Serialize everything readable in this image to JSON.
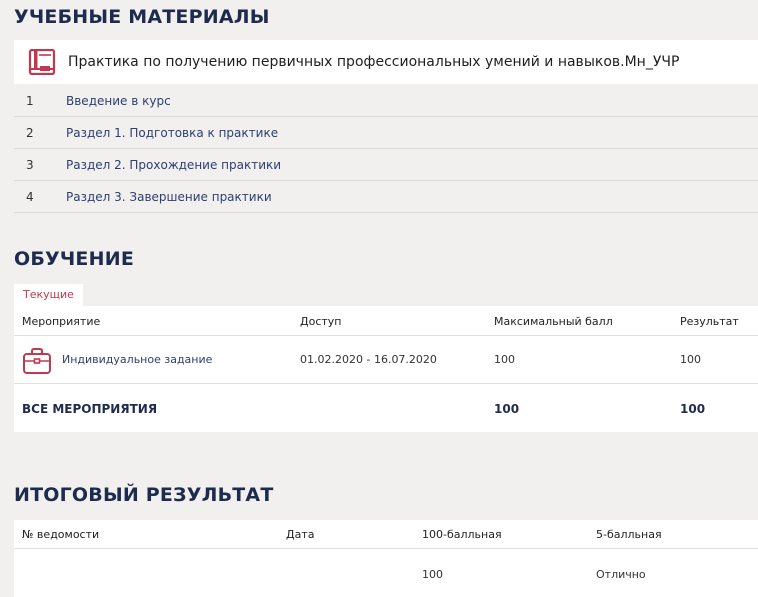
{
  "materials": {
    "title": "УЧЕБНЫЕ МАТЕРИАЛЫ",
    "course_title": "Практика по получению первичных профессиональных умений и навыков.Мн_УЧР",
    "items": [
      {
        "num": "1",
        "label": "Введение в курс"
      },
      {
        "num": "2",
        "label": "Раздел 1. Подготовка к практике"
      },
      {
        "num": "3",
        "label": "Раздел 2. Прохождение практики"
      },
      {
        "num": "4",
        "label": "Раздел 3. Завершение практики"
      }
    ]
  },
  "learning": {
    "title": "ОБУЧЕНИЕ",
    "tab_current": "Текущие",
    "headers": {
      "event": "Мероприятие",
      "access": "Доступ",
      "max": "Максимальный балл",
      "result": "Результат"
    },
    "rows": [
      {
        "event": "Индивидуальное задание",
        "access": "01.02.2020 - 16.07.2020",
        "max": "100",
        "result": "100"
      }
    ],
    "total": {
      "label": "ВСЕ МЕРОПРИЯТИЯ",
      "max": "100",
      "result": "100"
    }
  },
  "final": {
    "title": "ИТОГОВЫЙ РЕЗУЛЬТАТ",
    "headers": {
      "number": "№ ведомости",
      "date": "Дата",
      "score100": "100-балльная",
      "score5": "5-балльная"
    },
    "rows": [
      {
        "number": "",
        "date": "",
        "score100": "100",
        "score5": "Отлично"
      }
    ]
  },
  "colors": {
    "accent": "#c0394f",
    "heading": "#1d2b4f",
    "link": "#2c3f72",
    "background": "#f1f0ee"
  },
  "icons": {
    "course": "book-icon",
    "event": "briefcase-icon"
  }
}
